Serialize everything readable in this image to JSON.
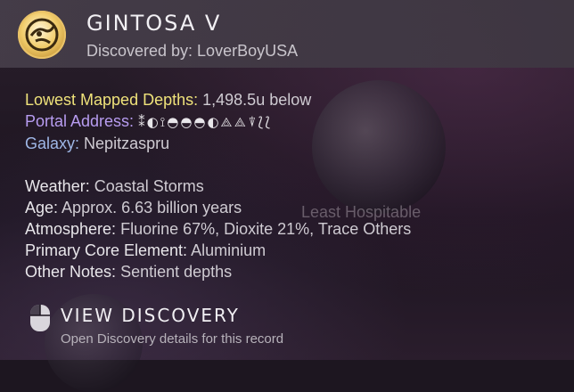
{
  "header": {
    "planet_name": "GINTOSA V",
    "discovered_by": "Discovered by: LoverBoyUSA",
    "badge_icon": "planet-discovery-icon"
  },
  "background": {
    "ghost_label": "Least Hospitable"
  },
  "info": {
    "lowest_depths": {
      "label": "Lowest Mapped Depths:",
      "value": "1,498.5u below"
    },
    "portal_address": {
      "label": "Portal Address:",
      "glyphs": "⁑◐⟟◓◓◓◐⟁⟁⍒⟅⟅"
    },
    "galaxy": {
      "label": "Galaxy:",
      "value": "Nepitzaspru"
    },
    "weather": {
      "label": "Weather:",
      "value": "Coastal Storms"
    },
    "age": {
      "label": "Age:",
      "value": "Approx. 6.63 billion years"
    },
    "atmosphere": {
      "label": "Atmosphere:",
      "value": "Fluorine 67%, Dioxite 21%, Trace Others"
    },
    "core": {
      "label": "Primary Core Element:",
      "value": "Aluminium"
    },
    "notes": {
      "label": "Other Notes:",
      "value": "Sentient depths"
    }
  },
  "cta": {
    "title": "VIEW DISCOVERY",
    "subtitle": "Open Discovery details for this record",
    "icon": "mouse-left-click-icon"
  },
  "colors": {
    "accent_yellow": "#efe27a",
    "accent_purple": "#b79cf0",
    "accent_blue": "#9fb7e6"
  }
}
